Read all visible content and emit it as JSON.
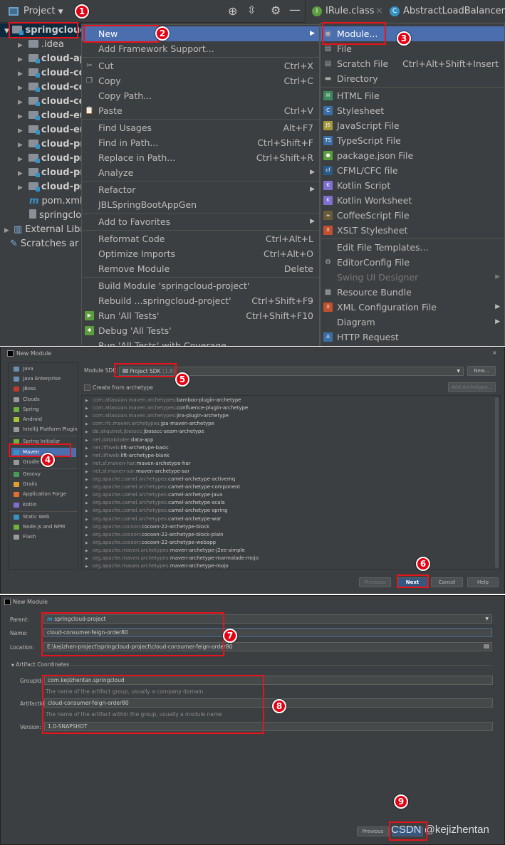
{
  "header": {
    "project_label": "Project",
    "tabs": [
      {
        "label": "IRule.class",
        "icon": "interface-icon"
      },
      {
        "label": "AbstractLoadBalancerRu",
        "icon": "class-icon"
      }
    ]
  },
  "tree": {
    "root": "springcloud",
    "items": [
      {
        "label": ".idea",
        "bold": false,
        "module": false,
        "arrow": true
      },
      {
        "label": "cloud-ap",
        "bold": true,
        "module": true,
        "arrow": true
      },
      {
        "label": "cloud-co",
        "bold": true,
        "module": true,
        "arrow": true
      },
      {
        "label": "cloud-co",
        "bold": true,
        "module": true,
        "arrow": true
      },
      {
        "label": "cloud-co",
        "bold": true,
        "module": true,
        "arrow": true
      },
      {
        "label": "cloud-eu",
        "bold": true,
        "module": true,
        "arrow": true
      },
      {
        "label": "cloud-eu",
        "bold": true,
        "module": true,
        "arrow": true
      },
      {
        "label": "cloud-pr",
        "bold": true,
        "module": true,
        "arrow": true
      },
      {
        "label": "cloud-pr",
        "bold": true,
        "module": true,
        "arrow": true
      },
      {
        "label": "cloud-pr",
        "bold": true,
        "module": true,
        "arrow": true
      },
      {
        "label": "cloud-pr",
        "bold": true,
        "module": true,
        "arrow": true
      },
      {
        "label": "pom.xml",
        "icon": "maven-icon"
      },
      {
        "label": "springclo",
        "icon": "file-icon"
      }
    ],
    "external": "External Libr",
    "scratches": "Scratches ar"
  },
  "context_menu": [
    {
      "label": "New",
      "submenu": true,
      "selected": true
    },
    {
      "label": "Add Framework Support..."
    },
    {
      "sep": true
    },
    {
      "label": "Cut",
      "shortcut": "Ctrl+X",
      "icon": "cut-icon"
    },
    {
      "label": "Copy",
      "shortcut": "Ctrl+C",
      "icon": "copy-icon"
    },
    {
      "label": "Copy Path..."
    },
    {
      "label": "Paste",
      "shortcut": "Ctrl+V",
      "icon": "paste-icon"
    },
    {
      "sep": true
    },
    {
      "label": "Find Usages",
      "shortcut": "Alt+F7"
    },
    {
      "label": "Find in Path...",
      "shortcut": "Ctrl+Shift+F"
    },
    {
      "label": "Replace in Path...",
      "shortcut": "Ctrl+Shift+R"
    },
    {
      "label": "Analyze",
      "submenu": true
    },
    {
      "sep": true
    },
    {
      "label": "Refactor",
      "submenu": true
    },
    {
      "label": "JBLSpringBootAppGen"
    },
    {
      "sep": true
    },
    {
      "label": "Add to Favorites",
      "submenu": true
    },
    {
      "sep": true
    },
    {
      "label": "Reformat Code",
      "shortcut": "Ctrl+Alt+L"
    },
    {
      "label": "Optimize Imports",
      "shortcut": "Ctrl+Alt+O"
    },
    {
      "label": "Remove Module",
      "shortcut": "Delete"
    },
    {
      "sep": true
    },
    {
      "label": "Build Module 'springcloud-project'"
    },
    {
      "label": "Rebuild ...springcloud-project'",
      "shortcut": "Ctrl+Shift+F9"
    },
    {
      "label": "Run 'All Tests'",
      "shortcut": "Ctrl+Shift+F10",
      "icon": "run-icon"
    },
    {
      "label": "Debug 'All Tests'",
      "icon": "debug-icon"
    },
    {
      "label": "Run 'All Tests' with Coverage"
    }
  ],
  "new_submenu": [
    {
      "label": "Module...",
      "selected": true,
      "icon": "module-icon"
    },
    {
      "label": "File",
      "icon": "file-icon"
    },
    {
      "label": "Scratch File",
      "shortcut": "Ctrl+Alt+Shift+Insert",
      "icon": "scratch-icon"
    },
    {
      "label": "Directory",
      "icon": "folder-icon"
    },
    {
      "sep": true
    },
    {
      "label": "HTML File",
      "icon": "html-icon"
    },
    {
      "label": "Stylesheet",
      "icon": "css-icon"
    },
    {
      "label": "JavaScript File",
      "icon": "js-icon"
    },
    {
      "label": "TypeScript File",
      "icon": "ts-icon"
    },
    {
      "label": "package.json File",
      "icon": "npm-icon"
    },
    {
      "label": "CFML/CFC file",
      "icon": "cfml-icon"
    },
    {
      "label": "Kotlin Script",
      "icon": "kotlin-icon"
    },
    {
      "label": "Kotlin Worksheet",
      "icon": "kotlin-icon"
    },
    {
      "label": "CoffeeScript File",
      "icon": "coffee-icon"
    },
    {
      "label": "XSLT Stylesheet",
      "icon": "xslt-icon"
    },
    {
      "sep": true
    },
    {
      "label": "Edit File Templates..."
    },
    {
      "label": "EditorConfig File",
      "icon": "gear-icon"
    },
    {
      "label": "Swing UI Designer",
      "submenu": true,
      "disabled": true
    },
    {
      "label": "Resource Bundle",
      "icon": "bundle-icon"
    },
    {
      "label": "XML Configuration File",
      "submenu": true,
      "icon": "xml-icon"
    },
    {
      "label": "Diagram",
      "submenu": true
    },
    {
      "label": "HTTP Request",
      "icon": "api-icon"
    }
  ],
  "dialog1": {
    "title": "New Module",
    "sidebar": [
      {
        "label": "Java",
        "color": "#6b8fb3"
      },
      {
        "label": "Java Enterprise",
        "color": "#6b8fb3"
      },
      {
        "label": "JBoss",
        "color": "#c0392b"
      },
      {
        "label": "Clouds",
        "color": "#999"
      },
      {
        "label": "Spring",
        "color": "#6db33f"
      },
      {
        "label": "Android",
        "color": "#a4c639"
      },
      {
        "label": "IntelliJ Platform Plugin",
        "color": "#999"
      },
      {
        "sep": true
      },
      {
        "label": "Spring Initializr",
        "color": "#6db33f"
      },
      {
        "label": "Maven",
        "color": "#3592c4",
        "selected": true
      },
      {
        "label": "Gradle",
        "color": "#999"
      },
      {
        "sep": true
      },
      {
        "label": "Groovy",
        "color": "#4a9a5b"
      },
      {
        "label": "Grails",
        "color": "#e0a030"
      },
      {
        "label": "Application Forge",
        "color": "#e07030"
      },
      {
        "label": "Kotlin",
        "color": "#7f6fd0"
      },
      {
        "sep": true
      },
      {
        "label": "Static Web",
        "color": "#3592c4"
      },
      {
        "label": "Node.js and NPM",
        "color": "#6db33f"
      },
      {
        "label": "Flash",
        "color": "#999"
      }
    ],
    "sdk_label": "Module SDK:",
    "sdk_value": "Project SDK",
    "sdk_version": "(1.8)",
    "new_button": "New...",
    "archetype_checkbox": "Create from archetype",
    "archetype_checked": false,
    "add_archetype": "Add Archetype...",
    "archetypes": [
      [
        "com.atlassian.maven.archetypes:",
        "bamboo-plugin-archetype"
      ],
      [
        "com.atlassian.maven.archetypes:",
        "confluence-plugin-archetype"
      ],
      [
        "com.atlassian.maven.archetypes:",
        "jira-plugin-archetype"
      ],
      [
        "com.rfc.maven.archetypes:",
        "jpa-maven-archetype"
      ],
      [
        "de.akquinet.jbosscc:",
        "jbosscc-seam-archetype"
      ],
      [
        "net.databinder:",
        "data-app"
      ],
      [
        "net.liftweb:",
        "lift-archetype-basic"
      ],
      [
        "net.liftweb:",
        "lift-archetype-blank"
      ],
      [
        "net.sf.maven-har:",
        "maven-archetype-har"
      ],
      [
        "net.sf.maven-sar:",
        "maven-archetype-sar"
      ],
      [
        "org.apache.camel.archetypes:",
        "camel-archetype-activemq"
      ],
      [
        "org.apache.camel.archetypes:",
        "camel-archetype-component"
      ],
      [
        "org.apache.camel.archetypes:",
        "camel-archetype-java"
      ],
      [
        "org.apache.camel.archetypes:",
        "camel-archetype-scala"
      ],
      [
        "org.apache.camel.archetypes:",
        "camel-archetype-spring"
      ],
      [
        "org.apache.camel.archetypes:",
        "camel-archetype-war"
      ],
      [
        "org.apache.cocoon:",
        "cocoon-22-archetype-block"
      ],
      [
        "org.apache.cocoon:",
        "cocoon-22-archetype-block-plain"
      ],
      [
        "org.apache.cocoon:",
        "cocoon-22-archetype-webapp"
      ],
      [
        "org.apache.maven.archetypes:",
        "maven-archetype-j2ee-simple"
      ],
      [
        "org.apache.maven.archetypes:",
        "maven-archetype-marmalade-mojo"
      ],
      [
        "org.apache.maven.archetypes:",
        "maven-archetype-mojo"
      ]
    ],
    "buttons": {
      "previous": "Previous",
      "next": "Next",
      "cancel": "Cancel",
      "help": "Help"
    }
  },
  "dialog2": {
    "title": "New Module",
    "parent_label": "Parent:",
    "parent_value": "springcloud-project",
    "name_label": "Name:",
    "name_value": "cloud-consumer-feign-order80",
    "location_label": "Location:",
    "location_value": "E:\\kejizhen-project\\springcloud-project\\cloud-consumer-feign-order80",
    "section": "Artifact Coordinates",
    "groupid_label": "GroupId:",
    "groupid_value": "com.kejizhentan.springcloud",
    "groupid_hint": "The name of the artifact group, usually a company domain",
    "artifactid_label": "ArtifactId:",
    "artifactid_value": "cloud-consumer-feign-order80",
    "artifactid_hint": "The name of the artifact within the group, usually a module name",
    "version_label": "Version:",
    "version_value": "1.0-SNAPSHOT",
    "previous": "Previous",
    "watermark": "CSDN @kejizhentan"
  },
  "badges": [
    "1",
    "2",
    "3",
    "4",
    "5",
    "6",
    "7",
    "8",
    "9"
  ],
  "colors": {
    "annotation": "#e8141b",
    "selection": "#4b6eaf",
    "background": "#3c3f41"
  }
}
